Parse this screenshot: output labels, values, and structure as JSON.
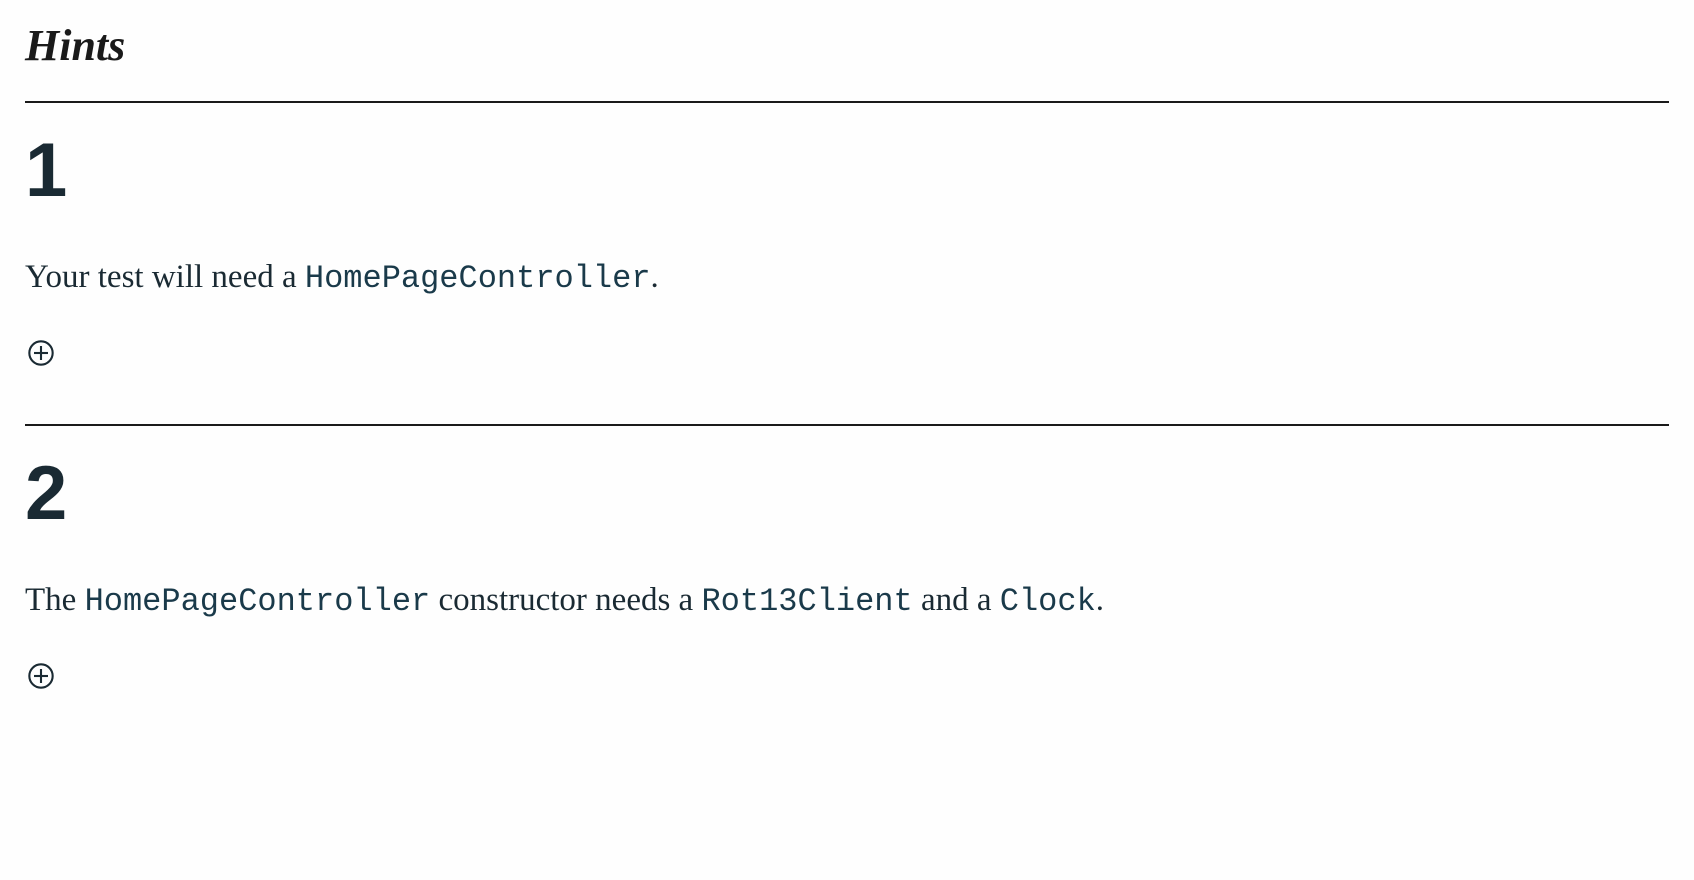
{
  "title": "Hints",
  "hints": [
    {
      "number": "1",
      "text_parts": [
        {
          "type": "text",
          "value": "Your test will need a "
        },
        {
          "type": "code",
          "value": "HomePageController"
        },
        {
          "type": "text",
          "value": "."
        }
      ]
    },
    {
      "number": "2",
      "text_parts": [
        {
          "type": "text",
          "value": "The "
        },
        {
          "type": "code",
          "value": "HomePageController"
        },
        {
          "type": "text",
          "value": " constructor needs a "
        },
        {
          "type": "code",
          "value": "Rot13Client"
        },
        {
          "type": "text",
          "value": " and a "
        },
        {
          "type": "code",
          "value": "Clock"
        },
        {
          "type": "text",
          "value": "."
        }
      ]
    }
  ]
}
